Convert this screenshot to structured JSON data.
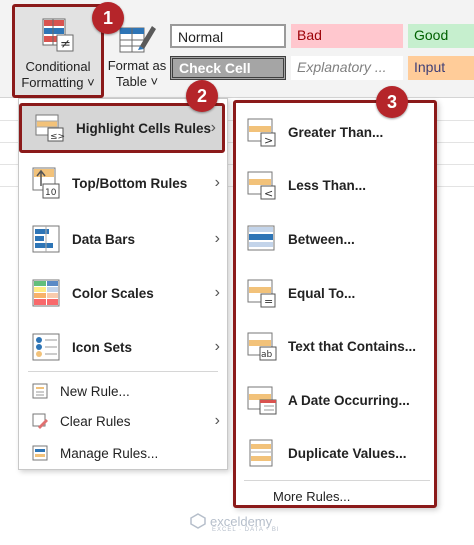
{
  "ribbon": {
    "conditional_formatting": {
      "line1": "Conditional",
      "line2": "Formatting ˅"
    },
    "format_as_table": {
      "line1": "Format as",
      "line2": "Table ˅"
    },
    "styles": [
      {
        "label": "Normal",
        "bg": "#ffffff",
        "fg": "#222222"
      },
      {
        "label": "Bad",
        "bg": "#ffc7ce",
        "fg": "#9c0006"
      },
      {
        "label": "Good",
        "bg": "#c6efce",
        "fg": "#006100"
      },
      {
        "label": "Check Cell",
        "bg": "#a5a5a5",
        "fg": "#ffffff"
      },
      {
        "label": "Explanatory ...",
        "bg": "#ffffff",
        "fg": "#7f7f7f"
      },
      {
        "label": "Input",
        "bg": "#ffcc99",
        "fg": "#3f3f76"
      }
    ]
  },
  "main_menu": {
    "items": [
      {
        "label": "Highlight Cells Rules",
        "icon": "highlight-cells-icon",
        "has_submenu": true
      },
      {
        "label": "Top/Bottom Rules",
        "icon": "top-bottom-icon",
        "has_submenu": true
      },
      {
        "label": "Data Bars",
        "icon": "data-bars-icon",
        "has_submenu": true
      },
      {
        "label": "Color Scales",
        "icon": "color-scales-icon",
        "has_submenu": true
      },
      {
        "label": "Icon Sets",
        "icon": "icon-sets-icon",
        "has_submenu": true
      }
    ],
    "actions": [
      {
        "label": "New Rule...",
        "icon": "new-rule-icon"
      },
      {
        "label": "Clear Rules",
        "icon": "clear-rules-icon",
        "has_submenu": true
      },
      {
        "label": "Manage Rules...",
        "icon": "manage-rules-icon"
      }
    ]
  },
  "submenu": {
    "items": [
      {
        "label": "Greater Than...",
        "icon": "greater-than-icon"
      },
      {
        "label": "Less Than...",
        "icon": "less-than-icon"
      },
      {
        "label": "Between...",
        "icon": "between-icon"
      },
      {
        "label": "Equal To...",
        "icon": "equal-to-icon"
      },
      {
        "label": "Text that Contains...",
        "icon": "text-contains-icon"
      },
      {
        "label": "A Date Occurring...",
        "icon": "date-occurring-icon"
      },
      {
        "label": "Duplicate Values...",
        "icon": "duplicate-values-icon"
      }
    ],
    "more_rules": "More Rules..."
  },
  "badges": [
    "1",
    "2",
    "3"
  ],
  "watermark": {
    "name": "exceldemy",
    "tagline": "EXCEL · DATA · BI"
  },
  "colors": {
    "callout_border": "#8b1a1a",
    "badge_fill": "#b5252a",
    "highlight_bg": "#d6d6d6"
  }
}
